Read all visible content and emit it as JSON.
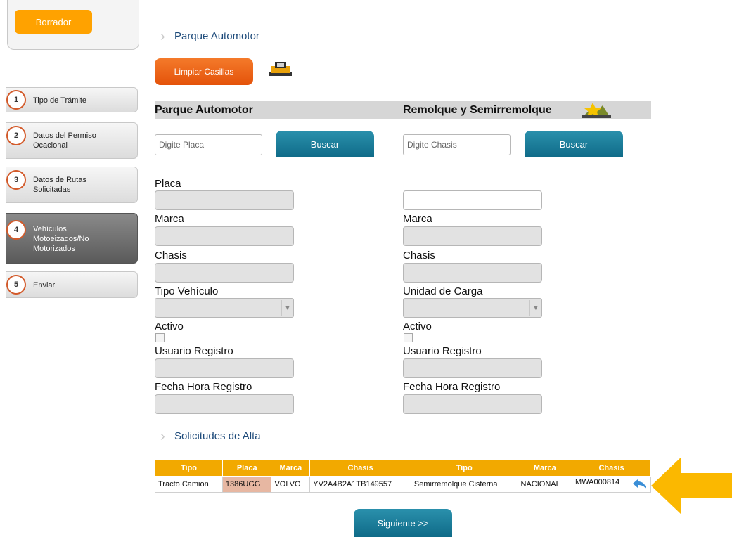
{
  "status": {
    "label": "Borrador"
  },
  "steps": [
    {
      "num": "1",
      "label": "Tipo de Trámite"
    },
    {
      "num": "2",
      "label": "Datos del Permiso Ocacional"
    },
    {
      "num": "3",
      "label": "Datos de Rutas Solicitadas"
    },
    {
      "num": "4",
      "label": "Vehículos Motoeizados/No Motorizados"
    },
    {
      "num": "5",
      "label": "Enviar"
    }
  ],
  "main": {
    "section_title": "Parque Automotor",
    "clear_button": "Limpiar Casillas",
    "left_heading": "Parque Automotor",
    "right_heading": "Remolque y Semirremolque"
  },
  "left": {
    "search_placeholder": "Digite Placa",
    "search_button": "Buscar",
    "labels": {
      "placa": "Placa",
      "marca": "Marca",
      "chasis": "Chasis",
      "tipo": "Tipo Vehículo",
      "activo": "Activo",
      "usuario": "Usuario Registro",
      "fecha": "Fecha Hora Registro"
    }
  },
  "right": {
    "search_placeholder": "Digite Chasis",
    "search_button": "Buscar",
    "labels": {
      "marca": "Marca",
      "chasis": "Chasis",
      "unidad": "Unidad de Carga",
      "activo": "Activo",
      "usuario": "Usuario Registro",
      "fecha": "Fecha Hora Registro"
    }
  },
  "requests": {
    "title": "Solicitudes de Alta",
    "headers": [
      "Tipo",
      "Placa",
      "Marca",
      "Chasis",
      "Tipo",
      "Marca",
      "Chasis"
    ],
    "row": {
      "tipo": "Tracto Camion",
      "placa": "1386UGG",
      "marca": "VOLVO",
      "chasis": "YV2A4B2A1TB149557",
      "tipo2": "Semirremolque Cisterna",
      "marca2": "NACIONAL",
      "chasis2": "MWA000814"
    }
  },
  "next_button": "Siguiente >>",
  "colors": {
    "orange": "#ffa200",
    "clear_button": "#e4520a",
    "teal_button": "#0f6b88",
    "table_header": "#f2a900",
    "plate_highlight": "#e7b7a2",
    "callout_arrow": "#fbb800"
  }
}
